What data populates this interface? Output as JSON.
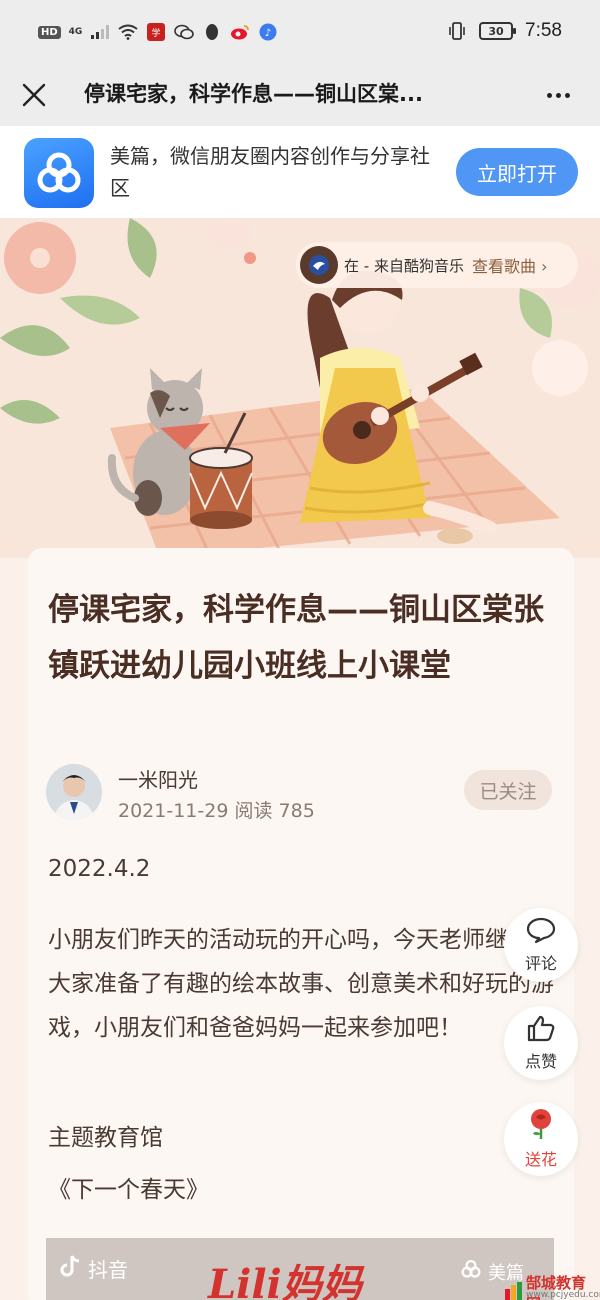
{
  "status_bar": {
    "hd_badge": "HD",
    "network": "4G",
    "time": "7:58",
    "battery": "30"
  },
  "nav": {
    "title": "停课宅家，科学作息——铜山区棠...",
    "close_icon": "close-icon",
    "more_icon": "more-dots-icon"
  },
  "app_banner": {
    "description": "美篇，微信朋友圈内容创作与分享社区",
    "open_button": "立即打开"
  },
  "music": {
    "track": "在 - 来自酷狗音乐",
    "link": "查看歌曲",
    "arrow": "›"
  },
  "article": {
    "title": "停课宅家，科学作息——铜山区棠张镇跃进幼儿园小班线上小课堂",
    "author": "一米阳光",
    "date": "2021-11-29",
    "reads_label": "阅读",
    "reads": "785",
    "follow": "已关注",
    "paragraphs": {
      "date": "2022.4.2",
      "body": "小朋友们昨天的活动玩的开心吗，今天老师继续为大家准备了有趣的绘本故事、创意美术和好玩的游戏，小朋友们和爸爸妈妈一起来参加吧！",
      "subheading": "主题教育馆",
      "book": "《下一个春天》"
    }
  },
  "video": {
    "watermark_left": "抖音",
    "script_text": "Lili妈妈",
    "watermark_right": "美篇"
  },
  "fab": {
    "comment": "评论",
    "like": "点赞",
    "flower": "送花"
  },
  "site_watermark": {
    "name": "郜城教育网",
    "url": "www.pcjyedu.com"
  },
  "colors": {
    "brand_blue": "#4f96f5",
    "title_brown": "#4a2e24",
    "accent_red": "#e0433c"
  }
}
